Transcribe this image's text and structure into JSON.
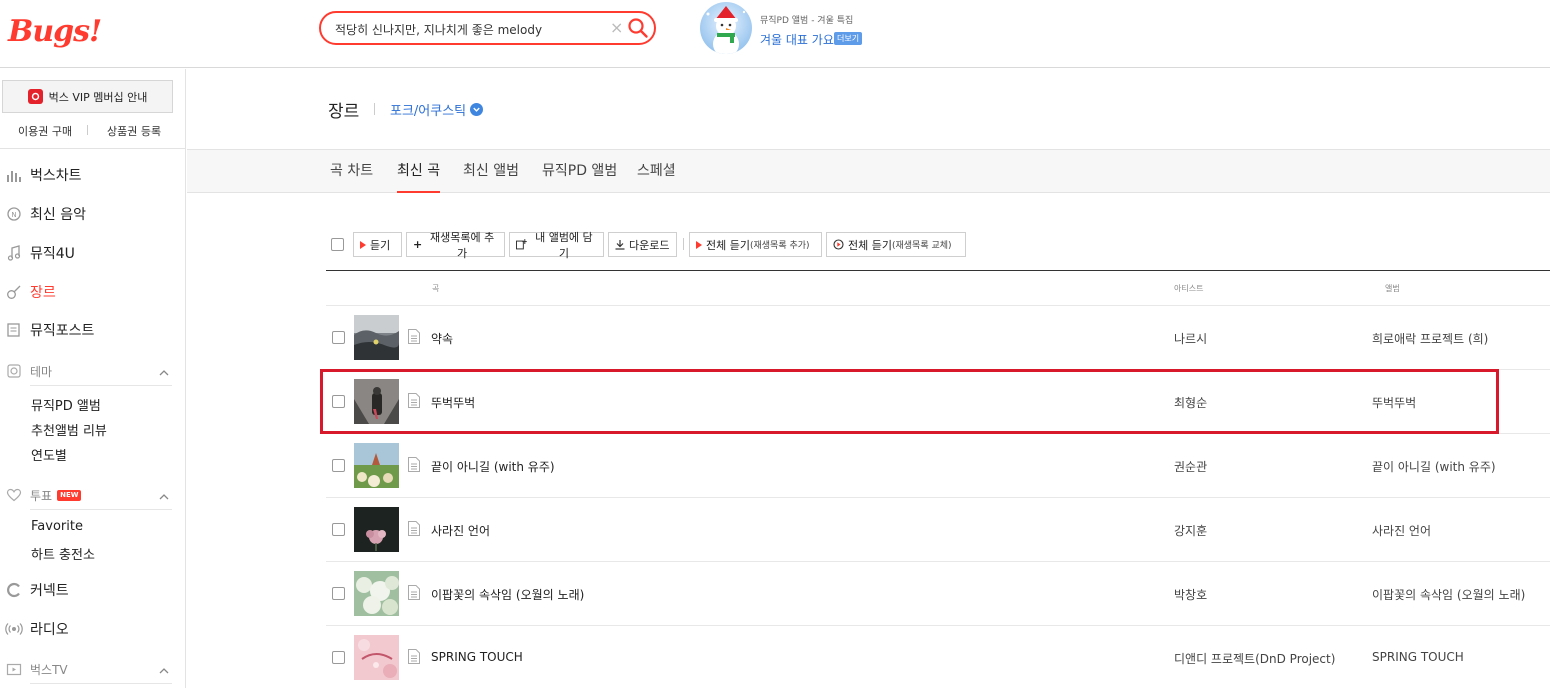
{
  "header": {
    "logo": "Bugs!",
    "search_value": "적당히 신나지만, 지나치게 좋은 melody",
    "promo_sub": "뮤직PD 앨범 - 겨울 특집",
    "promo_title": "겨울 대표 가요",
    "promo_more": "더보기"
  },
  "sidebar": {
    "vip": "벅스 VIP 멤버십 안내",
    "buy": "이용권 구매",
    "register": "상품권 등록",
    "nav": [
      "벅스차트",
      "최신 음악",
      "뮤직4U",
      "장르",
      "뮤직포스트"
    ],
    "theme": "테마",
    "theme_items": [
      "뮤직PD 앨범",
      "추천앨범 리뷰",
      "연도별"
    ],
    "vote": "투표",
    "vote_badge": "NEW",
    "vote_items": [
      "Favorite",
      "하트 충전소"
    ],
    "nav2": [
      "커넥트",
      "라디오"
    ],
    "tv": "벅스TV"
  },
  "genre": {
    "title": "장르",
    "selected": "포크/어쿠스틱"
  },
  "tabs": [
    "곡 차트",
    "최신 곡",
    "최신 앨범",
    "뮤직PD 앨범",
    "스페셜"
  ],
  "toolbar": {
    "listen": "듣기",
    "add_playlist": "재생목록에 추가",
    "add_album": "내 앨범에 담기",
    "download": "다운로드",
    "play_all_1": "전체 듣기",
    "play_all_1_sub": "(재생목록 추가)",
    "play_all_2": "전체 듣기",
    "play_all_2_sub": "(재생목록 교체)"
  },
  "columns": {
    "song": "곡",
    "artist": "아티스트",
    "album": "앨범"
  },
  "rows": [
    {
      "title": "약속",
      "artist": "나르시",
      "album": "희로애락 프로젝트 (희)"
    },
    {
      "title": "뚜벅뚜벅",
      "artist": "최형순",
      "album": "뚜벅뚜벅"
    },
    {
      "title": "끝이 아니길 (with 유주)",
      "artist": "권순관",
      "album": "끝이 아니길 (with 유주)"
    },
    {
      "title": "사라진 언어",
      "artist": "강지훈",
      "album": "사라진 언어"
    },
    {
      "title": "이팝꽃의 속삭임 (오월의 노래)",
      "artist": "박창호",
      "album": "이팝꽃의 속삭임 (오월의 노래)"
    },
    {
      "title": "SPRING TOUCH",
      "artist": "디앤디 프로젝트(DnD Project)",
      "album": "SPRING TOUCH"
    }
  ],
  "colors": {
    "accent": "#ff3b30",
    "link": "#2b6fd6",
    "highlight": "#d8192b"
  }
}
